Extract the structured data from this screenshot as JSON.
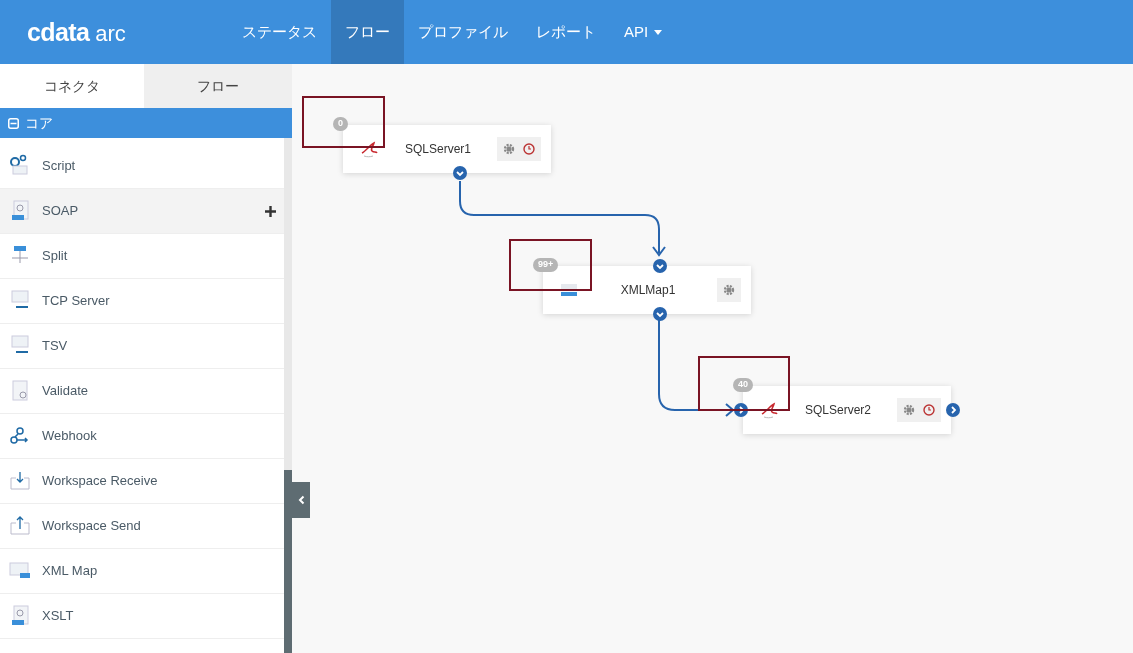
{
  "header": {
    "logo": "cdata",
    "logo_suffix": "arc",
    "nav": [
      {
        "label": "ステータス",
        "selected": false,
        "dropdown": false
      },
      {
        "label": "フロー",
        "selected": true,
        "dropdown": false
      },
      {
        "label": "プロファイル",
        "selected": false,
        "dropdown": false
      },
      {
        "label": "レポート",
        "selected": false,
        "dropdown": false
      },
      {
        "label": "API",
        "selected": false,
        "dropdown": true
      }
    ]
  },
  "sidebar": {
    "tabs": [
      {
        "label": "コネクタ",
        "selected": true
      },
      {
        "label": "フロー",
        "selected": false
      }
    ],
    "section": {
      "label": "コア",
      "expanded": true
    },
    "items": [
      {
        "label": "Script",
        "kind": "script",
        "highlighted": false
      },
      {
        "label": "SOAP",
        "kind": "soap",
        "highlighted": true
      },
      {
        "label": "Split",
        "kind": "split",
        "highlighted": false
      },
      {
        "label": "TCP Server",
        "kind": "tcp",
        "highlighted": false
      },
      {
        "label": "TSV",
        "kind": "tsv",
        "highlighted": false
      },
      {
        "label": "Validate",
        "kind": "validate",
        "highlighted": false
      },
      {
        "label": "Webhook",
        "kind": "webhook",
        "highlighted": false
      },
      {
        "label": "Workspace Receive",
        "kind": "receive",
        "highlighted": false
      },
      {
        "label": "Workspace Send",
        "kind": "send",
        "highlighted": false
      },
      {
        "label": "XML Map",
        "kind": "xmlmap",
        "highlighted": false
      },
      {
        "label": "XSLT",
        "kind": "xslt",
        "highlighted": false
      }
    ]
  },
  "canvas": {
    "nodes": [
      {
        "name": "SQLServer1",
        "kind": "sqlserver",
        "badge": "0",
        "schedule": true,
        "annotated": true
      },
      {
        "name": "XMLMap1",
        "kind": "xmlmap",
        "badge": "99+",
        "schedule": false,
        "annotated": true
      },
      {
        "name": "SQLServer2",
        "kind": "sqlserver",
        "badge": "40",
        "schedule": true,
        "annotated": true
      }
    ]
  }
}
